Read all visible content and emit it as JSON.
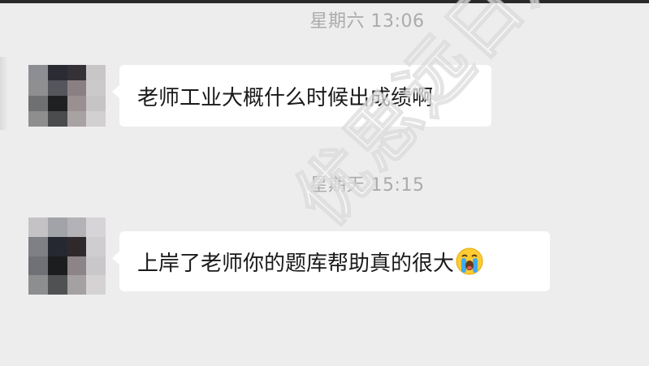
{
  "chat": {
    "timestamp_1": "星期六 13:06",
    "message_1": "老师工业大概什么时候出成绩啊",
    "timestamp_2": "星期天 15:15",
    "message_2": "上岸了老师你的题库帮助真的很大",
    "message_2_emoji": "loudly-crying-face-icon"
  },
  "watermark": {
    "text": "优思远日肃考升"
  },
  "colors": {
    "background": "#ededed",
    "bubble": "#ffffff",
    "timestamp": "#ababab",
    "text": "#1a1a1a"
  }
}
